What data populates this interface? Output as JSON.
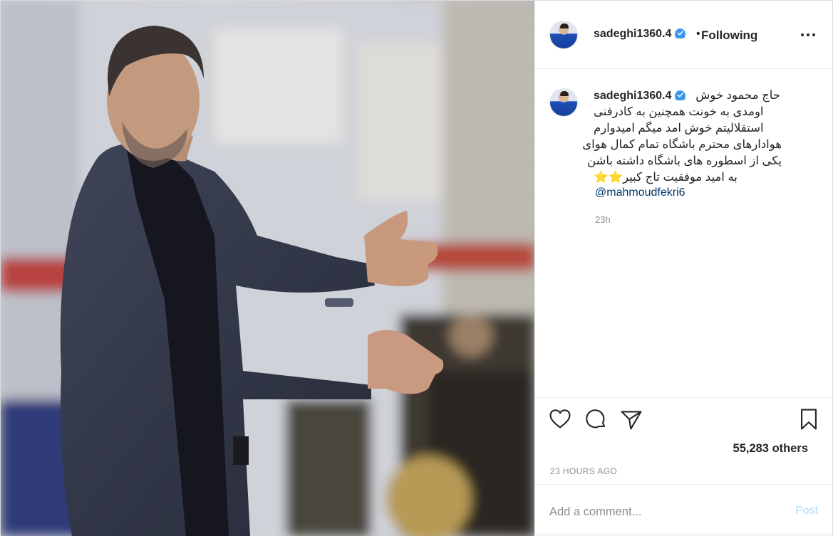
{
  "header": {
    "username": "sadeghi1360.4",
    "separator": "•",
    "follow_status": "Following",
    "more_icon": "more-horizontal-icon"
  },
  "caption": {
    "username": "sadeghi1360.4",
    "lines": [
      "حاج محمود خوش",
      "اومدی به خونت همچنین به کادرفنی",
      "استقلالیتم خوش امد میگم امیدوارم",
      "هوادارهای محترم باشگاه تمام کمال هوای",
      "یکی از اسطوره های باشگاه داشته باشن",
      "به امید موفقیت تاج کبیر⭐⭐"
    ],
    "mention": "@mahmoudfekri6",
    "time_ago": "23h"
  },
  "actions": {
    "like_icon": "heart-icon",
    "comment_icon": "comment-icon",
    "share_icon": "send-icon",
    "save_icon": "bookmark-icon",
    "likes_text": "55,283 others",
    "posted_time": "23 HOURS AGO"
  },
  "comment_form": {
    "placeholder": "Add a comment...",
    "post_label": "Post"
  },
  "colors": {
    "verified_badge": "#3897f0",
    "mention": "#00376b",
    "post_button_disabled": "#b2dffc",
    "secondary_text": "#8e8e8e"
  }
}
